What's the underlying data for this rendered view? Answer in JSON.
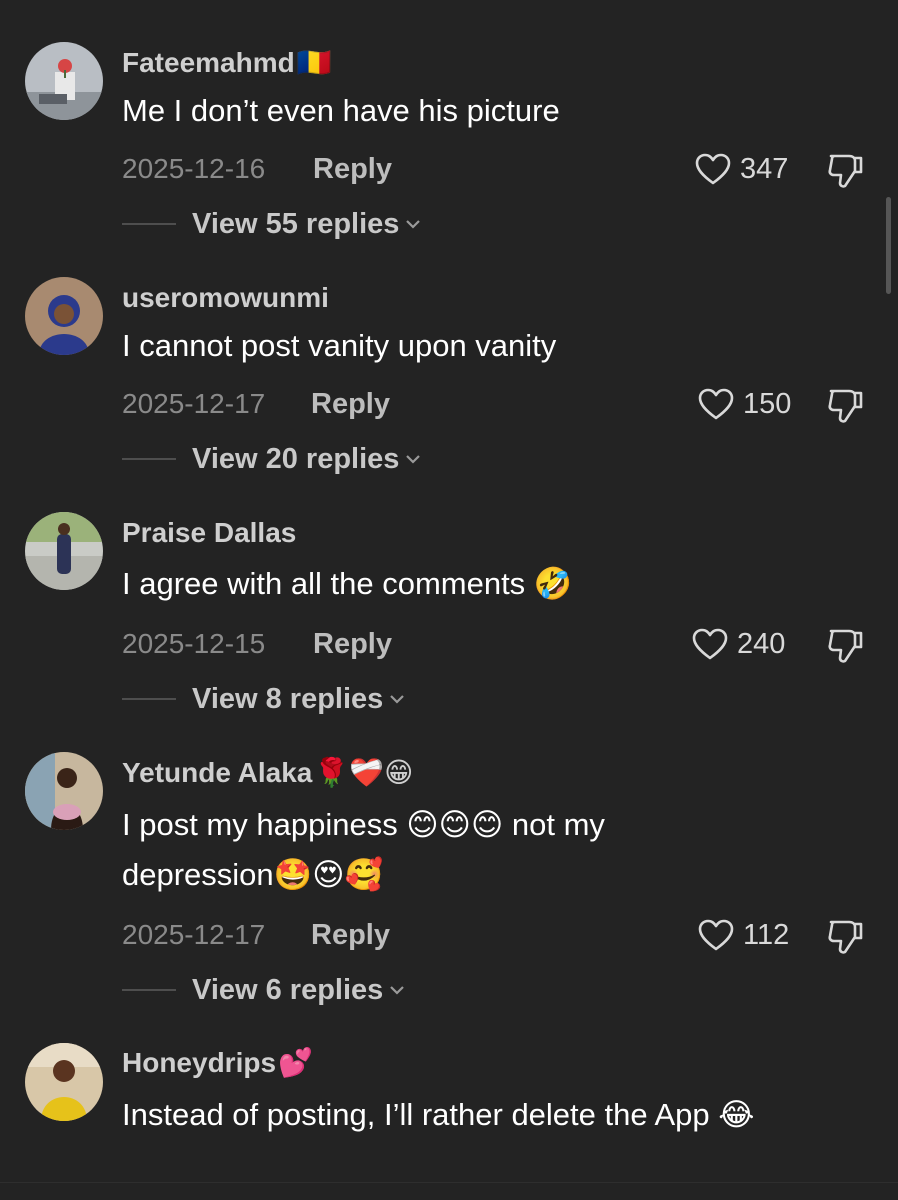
{
  "colors": {
    "background": "#232323",
    "username": "#cfcfcf",
    "comment_text": "#ffffff",
    "meta_text": "#8a8a8a",
    "reply_text": "#bdbdbd"
  },
  "comments": [
    {
      "username": "Fateemahmd",
      "username_emoji": "🇷🇴",
      "text": "Me I don’t even have his picture",
      "date": "2025-12-16",
      "reply_label": "Reply",
      "likes": "347",
      "view_replies": "View 55 replies"
    },
    {
      "username": "useromowunmi",
      "username_emoji": "",
      "text": "I cannot post vanity upon vanity",
      "date": "2025-12-17",
      "reply_label": "Reply",
      "likes": "150",
      "view_replies": "View 20 replies"
    },
    {
      "username": "Praise Dallas",
      "username_emoji": "",
      "text": "I agree with all the comments 🤣",
      "date": "2025-12-15",
      "reply_label": "Reply",
      "likes": "240",
      "view_replies": "View 8 replies"
    },
    {
      "username": "Yetunde Alaka",
      "username_emoji": "🌹❤️‍🩹😁",
      "text": "I post my happiness 😊😊😊 not my depression🤩😍🥰",
      "date": "2025-12-17",
      "reply_label": "Reply",
      "likes": "112",
      "view_replies": "View 6 replies"
    },
    {
      "username": "Honeydrips",
      "username_emoji": "💕",
      "text": "Instead of posting, I’ll rather delete the App 😂",
      "date": "",
      "reply_label": "",
      "likes": "",
      "view_replies": ""
    }
  ]
}
